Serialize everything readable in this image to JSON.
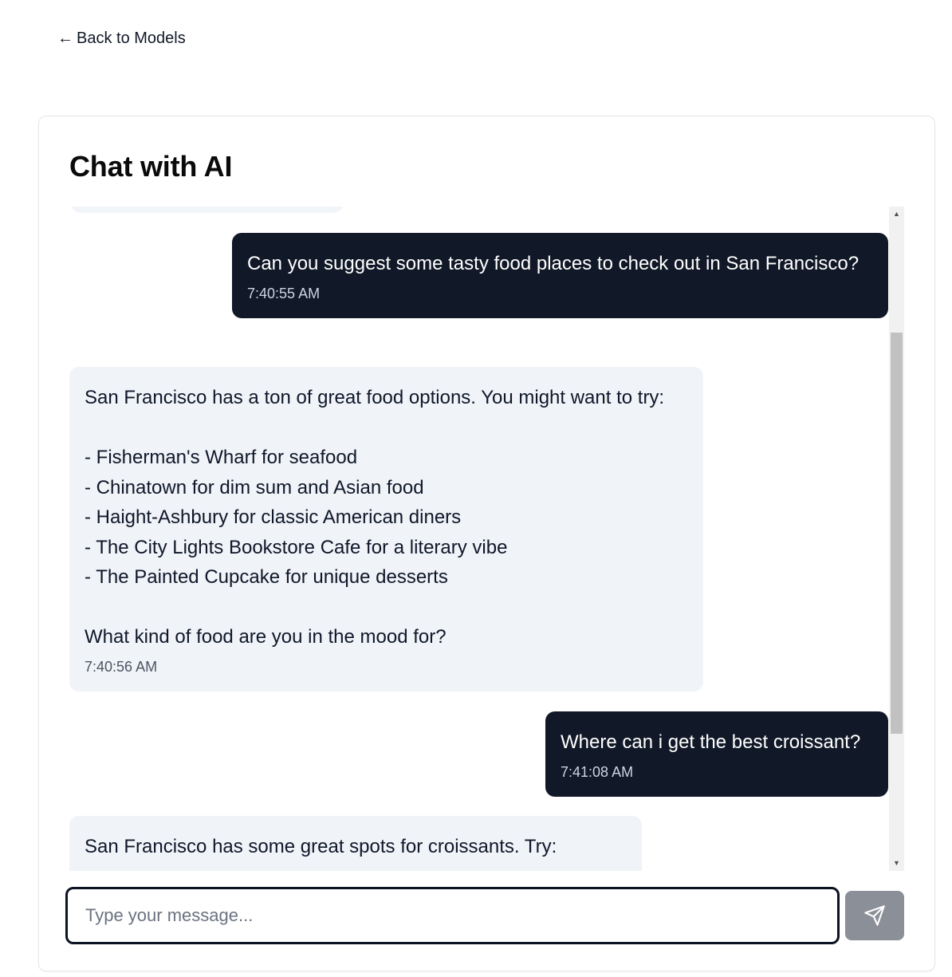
{
  "nav": {
    "back_arrow": "←",
    "back_label": "Back to Models"
  },
  "chat": {
    "title": "Chat with AI",
    "messages": [
      {
        "role": "user",
        "text": "Can you suggest some tasty food places to check out in San Francisco?",
        "time": "7:40:55 AM"
      },
      {
        "role": "assistant",
        "text": "San Francisco has a ton of great food options. You might want to try:\n\n- Fisherman's Wharf for seafood\n- Chinatown for dim sum and Asian food\n- Haight-Ashbury for classic American diners\n- The City Lights Bookstore Cafe for a literary vibe\n- The Painted Cupcake for unique desserts\n\nWhat kind of food are you in the mood for?",
        "time": "7:40:56 AM"
      },
      {
        "role": "user",
        "text": "Where can i get the best croissant?",
        "time": "7:41:08 AM"
      },
      {
        "role": "assistant",
        "text": "San Francisco has some great spots for croissants. Try:",
        "time": ""
      }
    ]
  },
  "composer": {
    "placeholder": "Type your message...",
    "send_icon": "send-icon"
  },
  "colors": {
    "user_bubble": "#111827",
    "assistant_bubble": "#f0f3f7",
    "send_button": "#8b8f97"
  }
}
